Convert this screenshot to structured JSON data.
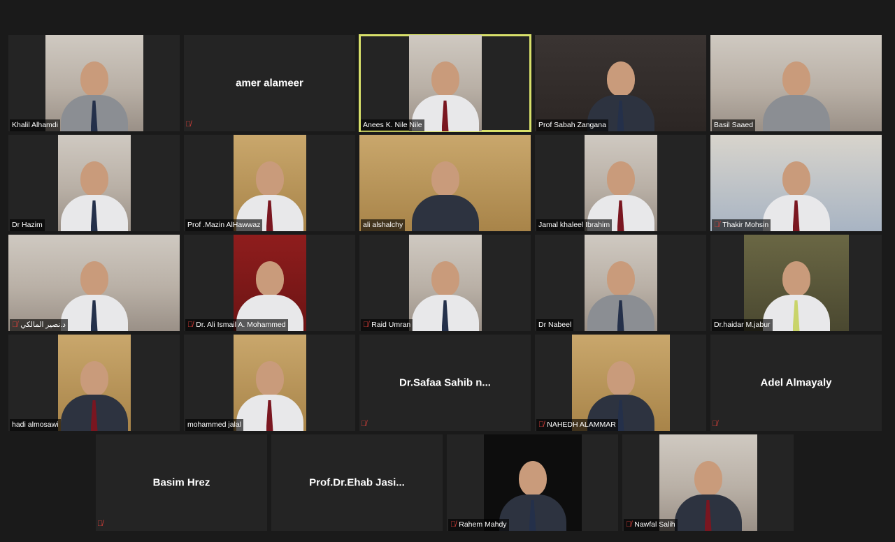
{
  "participants": [
    {
      "name": "Khalil Alhamdi",
      "muted": false,
      "video": true
    },
    {
      "name": "amer alameer",
      "muted": true,
      "video": false
    },
    {
      "name": "Anees K. Nile Nile",
      "muted": false,
      "video": true,
      "active_speaker": true
    },
    {
      "name": "Prof Sabah Zangana",
      "muted": false,
      "video": true
    },
    {
      "name": "Basil Saaed",
      "muted": false,
      "video": true
    },
    {
      "name": "Dr Hazim",
      "muted": false,
      "video": true
    },
    {
      "name": "Prof .Mazin AlHawwaz",
      "muted": false,
      "video": true
    },
    {
      "name": "ali alshalchy",
      "muted": false,
      "video": true
    },
    {
      "name": "Jamal khaleel Ibrahim",
      "muted": false,
      "video": true
    },
    {
      "name": "Thakir Mohsin",
      "muted": true,
      "video": true
    },
    {
      "name": "د.نصير المالكي",
      "muted": true,
      "video": true
    },
    {
      "name": "Dr. Ali Ismail A. Mohammed",
      "muted": true,
      "video": true
    },
    {
      "name": "Raid Umran",
      "muted": true,
      "video": true
    },
    {
      "name": "Dr Nabeel",
      "muted": false,
      "video": true
    },
    {
      "name": "Dr.haidar M.jabur",
      "muted": false,
      "video": true
    },
    {
      "name": "hadi almosawi",
      "muted": false,
      "video": true
    },
    {
      "name": "mohammed jalal",
      "muted": false,
      "video": true
    },
    {
      "name": "Dr.Safaa  Sahib  n...",
      "muted": true,
      "video": false
    },
    {
      "name": "NAHEDH ALAMMAR",
      "muted": true,
      "video": true
    },
    {
      "name": "Adel Almayaly",
      "muted": true,
      "video": false
    },
    {
      "name": "Basim Hrez",
      "muted": true,
      "video": false
    },
    {
      "name": "Prof.Dr.Ehab  Jasi...",
      "muted": false,
      "video": false
    },
    {
      "name": "Rahem Mahdy",
      "muted": true,
      "video": true
    },
    {
      "name": "Nawfal Salih",
      "muted": true,
      "video": true
    }
  ],
  "icons": {
    "mic_muted": "mic-off-icon"
  },
  "colors": {
    "active_speaker_border": "#d8e06a",
    "mute_icon": "#e0403a",
    "tile_bg": "#242424"
  }
}
